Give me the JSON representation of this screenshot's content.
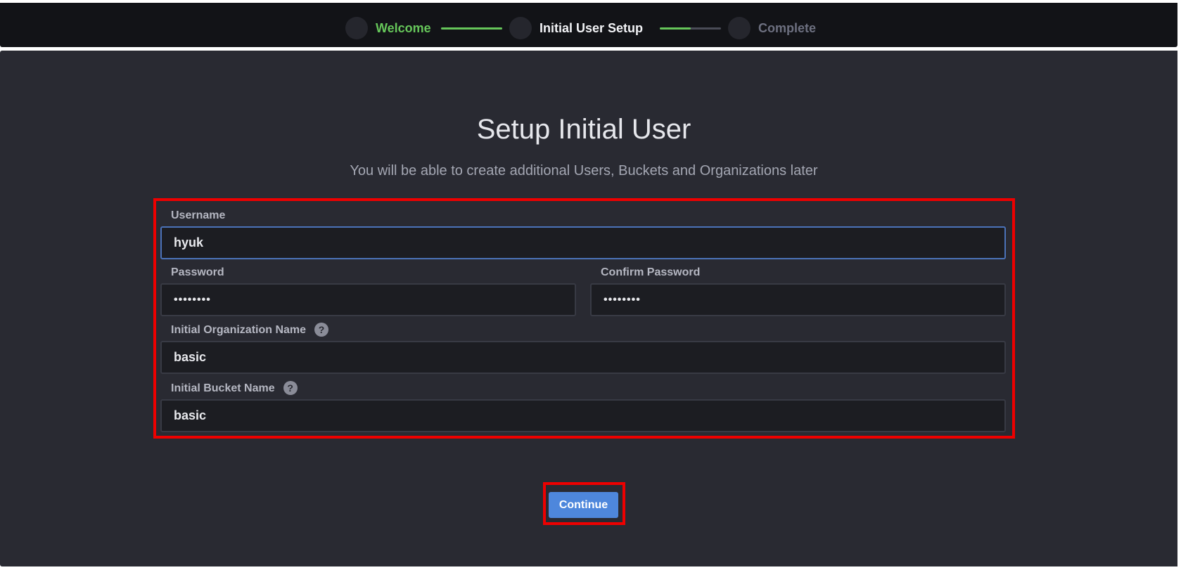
{
  "stepper": {
    "steps": [
      {
        "label": "Welcome",
        "state": "done"
      },
      {
        "label": "Initial User Setup",
        "state": "active"
      },
      {
        "label": "Complete",
        "state": "pending"
      }
    ],
    "progress_step1_to_2": 1.0,
    "progress_step2_to_3": 0.5
  },
  "page": {
    "title": "Setup Initial User",
    "subtitle": "You will be able to create additional Users, Buckets and Organizations later"
  },
  "form": {
    "username": {
      "label": "Username",
      "value": "hyuk"
    },
    "password": {
      "label": "Password",
      "value": "••••••••"
    },
    "confirm_password": {
      "label": "Confirm Password",
      "value": "••••••••"
    },
    "organization": {
      "label": "Initial Organization Name",
      "value": "basic",
      "help_glyph": "?"
    },
    "bucket": {
      "label": "Initial Bucket Name",
      "value": "basic",
      "help_glyph": "?"
    }
  },
  "actions": {
    "continue_label": "Continue"
  },
  "colors": {
    "accent_blue": "#4e87dc",
    "success_green": "#66c65a",
    "highlight_red": "#ee0000",
    "panel_bg": "#292a32"
  }
}
